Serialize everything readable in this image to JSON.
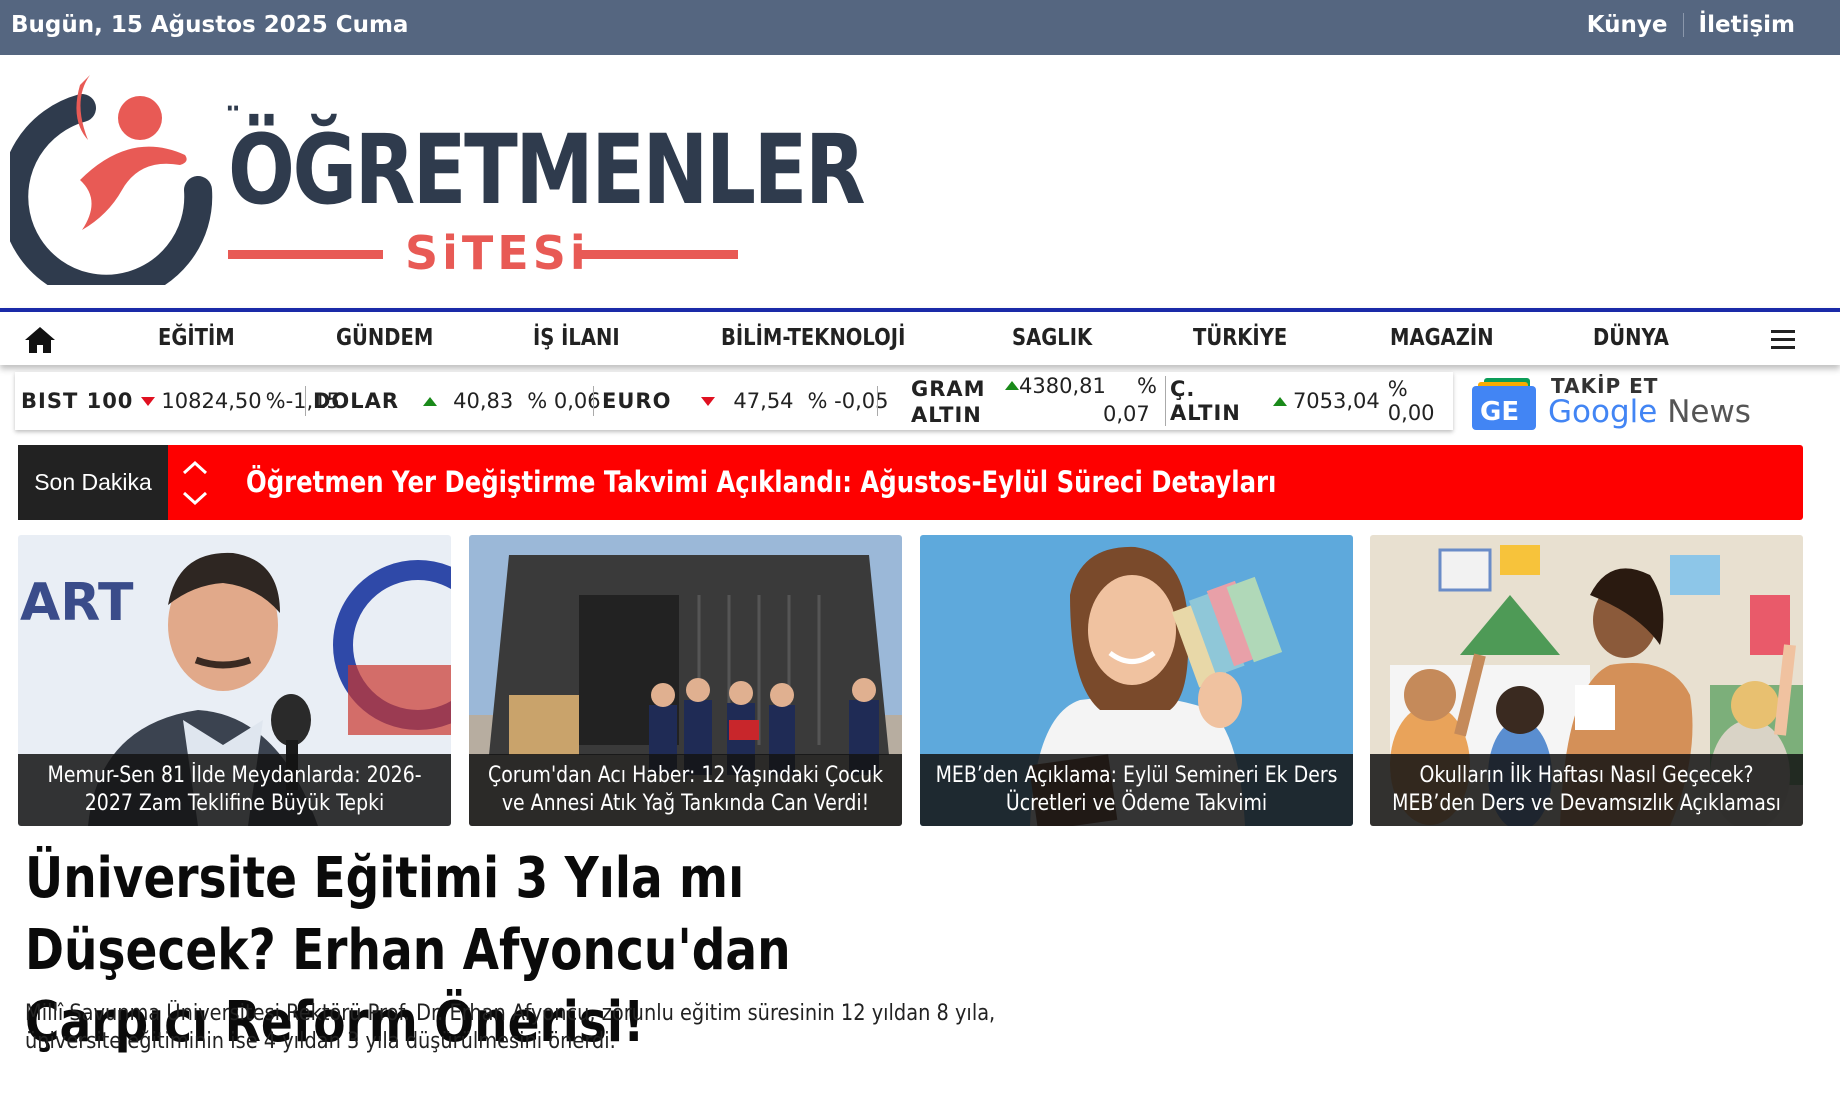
{
  "topbar": {
    "date": "Bugün, 15 Ağustos 2025 Cuma",
    "links": [
      "Künye",
      "İletişim"
    ]
  },
  "logo": {
    "title": "ĞRETMENLER",
    "subtitle": "SiTESi",
    "colors": {
      "primary": "#2f3b4d",
      "accent": "#e85a55"
    }
  },
  "nav": {
    "home_icon": "home-icon",
    "items": [
      "EĞİTİM",
      "GÜNDEM",
      "İŞ İLANI",
      "BİLİM-TEKNOLOJİ",
      "SAGLIK",
      "TÜRKİYE",
      "MAGAZİN",
      "DÜNYA"
    ],
    "menu_icon": "hamburger-icon",
    "border_color": "#1a2aa8"
  },
  "ticker": {
    "bist": {
      "label": "BIST 100",
      "direction": "down",
      "value": "10824,50",
      "change": "%-1,15"
    },
    "dolar": {
      "label": "DOLAR",
      "direction": "up",
      "value": "40,83",
      "change": "% 0,06"
    },
    "euro": {
      "label": "EURO",
      "direction": "down",
      "value": "47,54",
      "change": "% -0,05"
    },
    "gram": {
      "label1": "GRAM",
      "label2": "ALTIN",
      "direction": "up",
      "value": "4380,81",
      "change1": "%",
      "change2": "0,07"
    },
    "ceyrek": {
      "label": "Ç. ALTIN",
      "direction": "up",
      "value": "7053,04",
      "change": "% 0,00"
    }
  },
  "gnews": {
    "takip": "TAKİP ET",
    "google": "Google",
    "news": "News",
    "badge": "GE"
  },
  "breaking": {
    "tag": "Son Dakika",
    "headline": "Öğretmen Yer Değiştirme Takvimi Açıklandı: Ağustos-Eylül Süreci Detayları",
    "color": "#fe0000"
  },
  "cards": [
    {
      "caption": "Memur-Sen 81 İlde Meydanlarda: 2026-2027 Zam Teklifine Büyük Tepki",
      "image": "man-speaking-microphone"
    },
    {
      "caption": "Çorum'dan Acı Haber: 12 Yaşındaki Çocuk ve Annesi Atık Yağ Tankında Can Verdi!",
      "image": "police-at-warehouse-gate"
    },
    {
      "caption": "MEB’den Açıklama: Eylül Semineri Ek Ders Ücretleri ve Ödeme Takvimi",
      "image": "teacher-holding-money"
    },
    {
      "caption": "Okulların İlk Haftası Nasıl Geçecek? MEB’den Ders ve Devamsızlık Açıklaması",
      "image": "classroom-children"
    }
  ],
  "article": {
    "title": "Üniversite Eğitimi 3 Yıla mı Düşecek? Erhan Afyoncu'dan Çarpıcı Reform Önerisi!",
    "summary": "Millî Savunma Üniversitesi Rektörü Prof. Dr. Erhan Afyoncu, zorunlu eğitim süresinin 12 yıldan 8 yıla, üniversite eğitiminin ise 4 yıldan 3 yıla düşürülmesini önerdi."
  }
}
